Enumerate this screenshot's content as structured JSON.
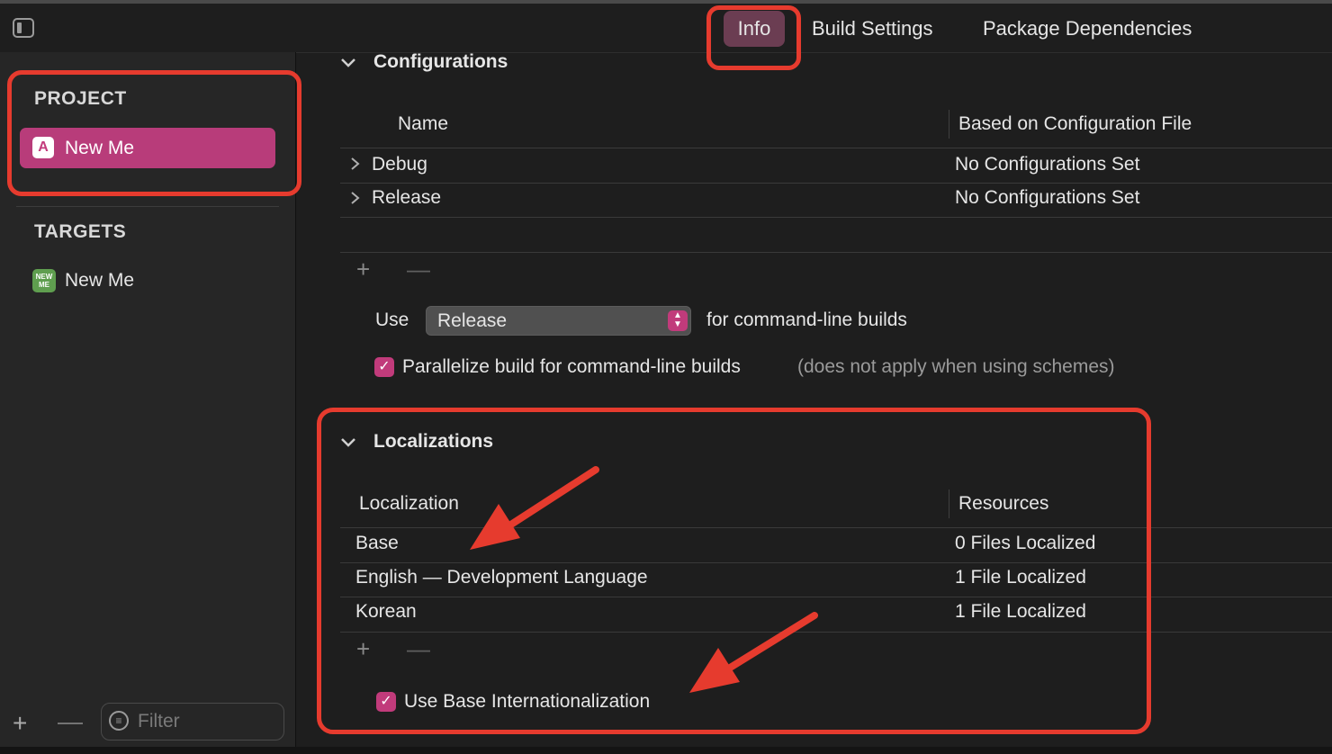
{
  "tabs": {
    "info": "Info",
    "build_settings": "Build Settings",
    "package_dependencies": "Package Dependencies"
  },
  "sidebar": {
    "project_header": "PROJECT",
    "project_item": "New Me",
    "targets_header": "TARGETS",
    "target_item": "New Me",
    "target_icon_text": "NEW ME",
    "filter_placeholder": "Filter"
  },
  "configurations": {
    "title": "Configurations",
    "columns": [
      "Name",
      "Based on Configuration File"
    ],
    "rows": [
      {
        "name": "Debug",
        "file": "No Configurations Set"
      },
      {
        "name": "Release",
        "file": "No Configurations Set"
      }
    ],
    "use_label": "Use",
    "use_value": "Release",
    "use_suffix": "for command-line builds",
    "parallelize_label": "Parallelize build for command-line builds",
    "parallelize_note": "(does not apply when using schemes)",
    "parallelize_checked": true
  },
  "localizations": {
    "title": "Localizations",
    "columns": [
      "Localization",
      "Resources"
    ],
    "rows": [
      {
        "name": "Base",
        "resources": "0 Files Localized"
      },
      {
        "name": "English — Development Language",
        "resources": "1 File Localized"
      },
      {
        "name": "Korean",
        "resources": "1 File Localized"
      }
    ],
    "base_i18n_label": "Use Base Internationalization",
    "base_i18n_checked": true
  },
  "symbols": {
    "plus": "+",
    "minus": "—",
    "chevron_down": "⌄",
    "chevron_right": "›",
    "check": "✓",
    "stepper": "⌃⌄"
  },
  "colors": {
    "accent": "#c13b7b",
    "annotation_red": "#e63b2e",
    "background": "#1e1e1e",
    "sidebar": "#262626"
  }
}
